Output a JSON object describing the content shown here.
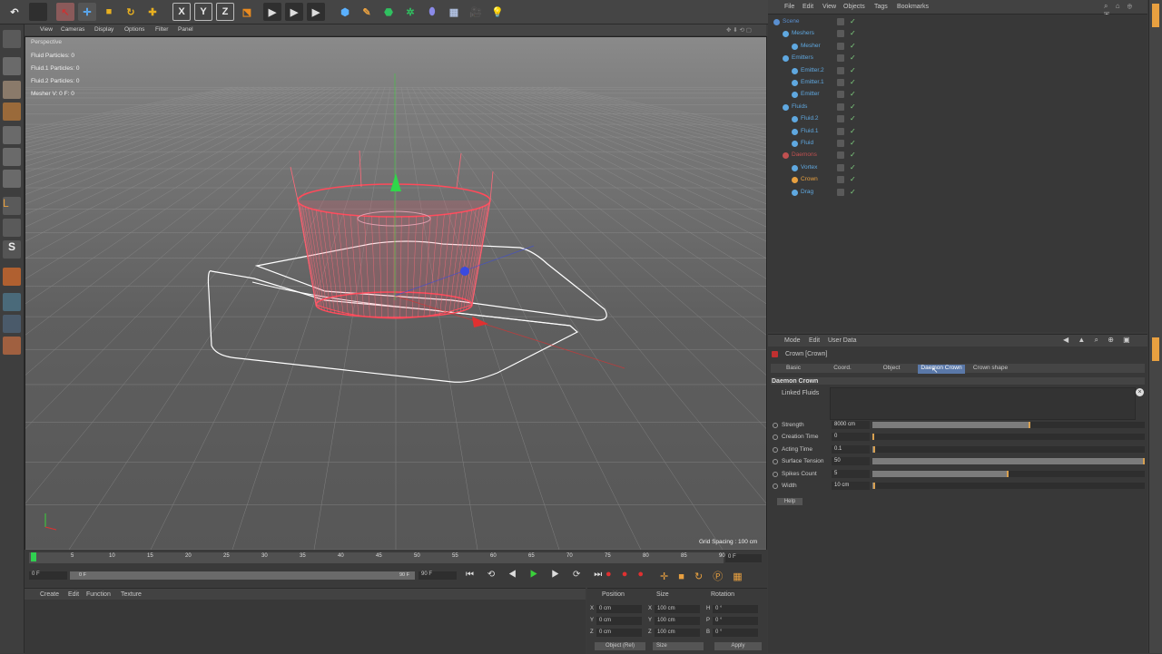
{
  "topbar": {
    "x_btn": "X",
    "y_btn": "Y",
    "z_btn": "Z"
  },
  "viewport": {
    "menu": [
      "View",
      "Cameras",
      "Display",
      "Options",
      "Filter",
      "Panel"
    ],
    "label": "Perspective",
    "hud": [
      "Fluid Particles: 0",
      "Fluid.1 Particles: 0",
      "Fluid.2 Particles: 0",
      "Mesher V: 0 F: 0"
    ],
    "grid_spacing": "Grid Spacing : 100 cm"
  },
  "timeline": {
    "ticks": [
      "0",
      "5",
      "10",
      "15",
      "20",
      "25",
      "30",
      "35",
      "40",
      "45",
      "50",
      "55",
      "60",
      "65",
      "70",
      "75",
      "80",
      "85",
      "90"
    ],
    "current_frame": "0 F",
    "start_frame": "0 F",
    "end_frame": "90 F",
    "range_end": "90 F",
    "range_start": "0 F"
  },
  "materials": {
    "menu": [
      "Create",
      "Edit",
      "Function",
      "Texture"
    ]
  },
  "coords": {
    "headers": [
      "Position",
      "Size",
      "Rotation"
    ],
    "rows": [
      {
        "a": "X",
        "av": "0 cm",
        "b": "X",
        "bv": "100 cm",
        "c": "H",
        "cv": "0 °"
      },
      {
        "a": "Y",
        "av": "0 cm",
        "b": "Y",
        "bv": "100 cm",
        "c": "P",
        "cv": "0 °"
      },
      {
        "a": "Z",
        "av": "0 cm",
        "b": "Z",
        "bv": "100 cm",
        "c": "B",
        "cv": "0 °"
      }
    ],
    "mode_select": "Object (Rel)",
    "size_select": "Size",
    "apply": "Apply"
  },
  "objmgr": {
    "menu": [
      "File",
      "Edit",
      "View",
      "Objects",
      "Tags",
      "Bookmarks"
    ],
    "items": [
      {
        "name": "Scene",
        "indent": 0,
        "color": "#5a8fd0"
      },
      {
        "name": "Meshers",
        "indent": 1,
        "color": "#5fa8e0"
      },
      {
        "name": "Mesher",
        "indent": 2,
        "color": "#5fa8e0"
      },
      {
        "name": "Emitters",
        "indent": 1,
        "color": "#5fa8e0"
      },
      {
        "name": "Emitter.2",
        "indent": 2,
        "color": "#5fa8e0"
      },
      {
        "name": "Emitter.1",
        "indent": 2,
        "color": "#5fa8e0"
      },
      {
        "name": "Emitter",
        "indent": 2,
        "color": "#5fa8e0"
      },
      {
        "name": "Fluids",
        "indent": 1,
        "color": "#5fa8e0"
      },
      {
        "name": "Fluid.2",
        "indent": 2,
        "color": "#5fa8e0"
      },
      {
        "name": "Fluid.1",
        "indent": 2,
        "color": "#5fa8e0"
      },
      {
        "name": "Fluid",
        "indent": 2,
        "color": "#5fa8e0"
      },
      {
        "name": "Daemons",
        "indent": 1,
        "color": "#c05050"
      },
      {
        "name": "Vortex",
        "indent": 2,
        "color": "#5fa8e0"
      },
      {
        "name": "Crown",
        "indent": 2,
        "color": "#e8a040"
      },
      {
        "name": "Drag",
        "indent": 2,
        "color": "#5fa8e0"
      }
    ]
  },
  "attr": {
    "menu": [
      "Mode",
      "Edit",
      "User Data"
    ],
    "title": "Crown [Crown]",
    "tabs": [
      "Basic",
      "Coord.",
      "Object",
      "Daemon Crown",
      "Crown shape"
    ],
    "section": "Daemon Crown",
    "linked_label": "Linked Fluids",
    "params": [
      {
        "label": "Strength",
        "value": "8000 cm",
        "fill": 0.58
      },
      {
        "label": "Creation Time",
        "value": "0",
        "fill": 0.0
      },
      {
        "label": "Acting Time",
        "value": "0.1",
        "fill": 0.01
      },
      {
        "label": "Surface Tension",
        "value": "50",
        "fill": 1.0
      },
      {
        "label": "Spikes Count",
        "value": "5",
        "fill": 0.5
      },
      {
        "label": "Width",
        "value": "10 cm",
        "fill": 0.01
      }
    ],
    "help": "Help"
  }
}
